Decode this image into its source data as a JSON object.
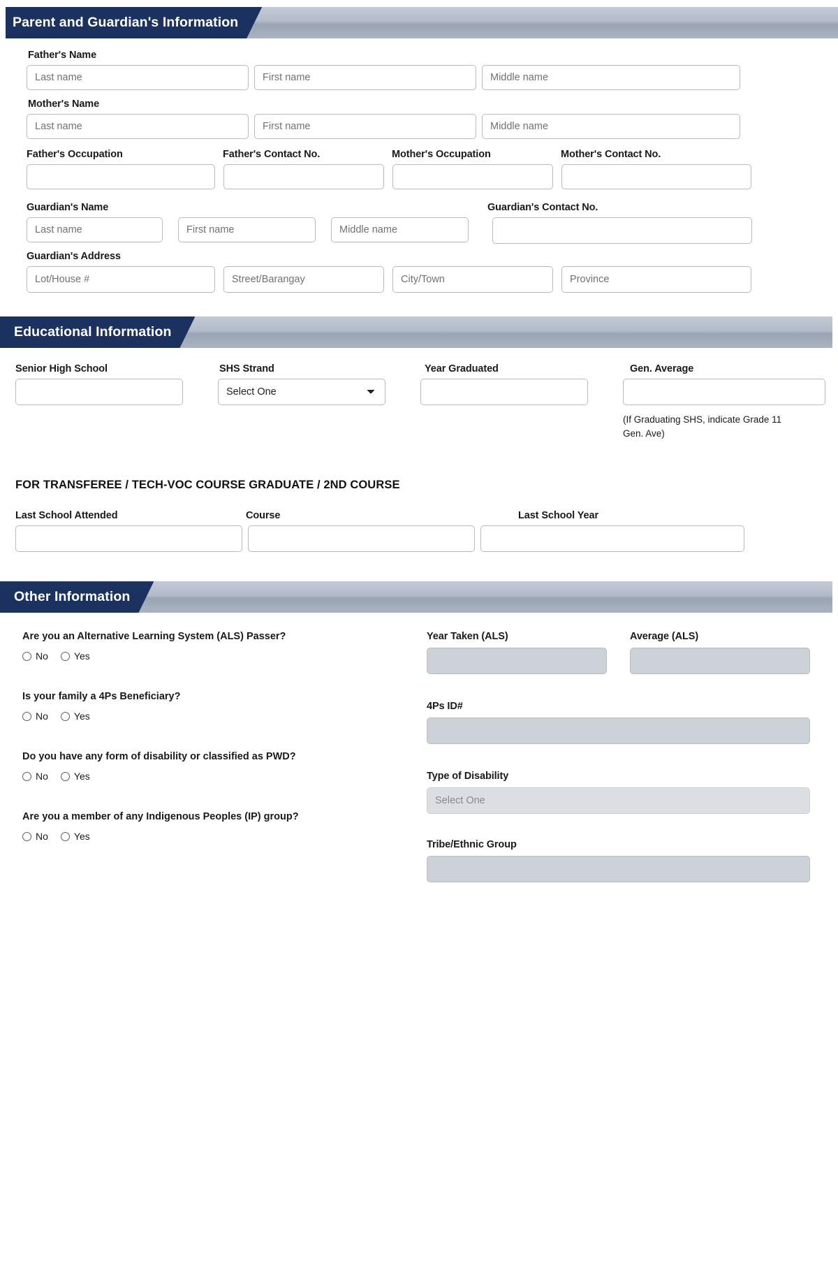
{
  "sections": {
    "parent": {
      "title": "Parent and Guardian's Information",
      "fathers_name_label": "Father's Name",
      "mothers_name_label": "Mother's Name",
      "name_placeholders": {
        "last": "Last name",
        "first": "First name",
        "middle": "Middle name"
      },
      "occupation_labels": [
        "Father's Occupation",
        "Father's Contact No.",
        "Mother's Occupation",
        "Mother's Contact No."
      ],
      "guardian_name_label": "Guardian's Name",
      "guardian_contact_label": "Guardian's Contact No.",
      "guardian_address_label": "Guardian's Address",
      "address_placeholders": {
        "lot": "Lot/House #",
        "street": "Street/Barangay",
        "city": "City/Town",
        "province": "Province"
      }
    },
    "educational": {
      "title": "Educational Information",
      "labels": {
        "shs": "Senior High School",
        "strand": "SHS Strand",
        "year_graduated": "Year Graduated",
        "gen_average": "Gen. Average"
      },
      "strand_selected": "Select One",
      "strand_options": [
        "Select One"
      ],
      "gen_average_note": "(If Graduating SHS, indicate Grade 11 Gen. Ave)",
      "transferee_heading": "FOR TRANSFEREE / TECH-VOC COURSE GRADUATE / 2ND COURSE",
      "transferee_labels": {
        "last_school": "Last School Attended",
        "course": "Course",
        "last_school_year": "Last School Year"
      }
    },
    "other": {
      "title": "Other Information",
      "questions": [
        {
          "text": "Are you an Alternative Learning System (ALS) Passer?",
          "options": [
            "No",
            "Yes"
          ]
        },
        {
          "text": "Is your family a 4Ps Beneficiary?",
          "options": [
            "No",
            "Yes"
          ]
        },
        {
          "text": "Do you have any form of disability or classified as PWD?",
          "options": [
            "No",
            "Yes"
          ]
        },
        {
          "text": "Are you a member of any Indigenous Peoples (IP) group?",
          "options": [
            "No",
            "Yes"
          ]
        }
      ],
      "right_labels": {
        "year_taken": "Year Taken (ALS)",
        "average_als": "Average (ALS)",
        "fourps_id": "4Ps ID#",
        "type_of_disability": "Type of Disability",
        "tribe": "Tribe/Ethnic Group"
      },
      "disability_selected": "Select One",
      "disability_options": [
        "Select One"
      ]
    }
  },
  "colors": {
    "banner_navy": "#1b3260",
    "banner_gray": "#aab3c1",
    "field_border": "#b6bbc0",
    "disabled_bg": "#ccd2d8"
  }
}
